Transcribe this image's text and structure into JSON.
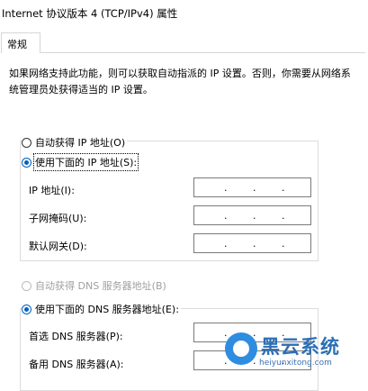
{
  "window": {
    "title": "Internet 协议版本 4 (TCP/IPv4) 属性"
  },
  "tabs": [
    {
      "label": "常规"
    }
  ],
  "description": "如果网络支持此功能，则可以获取自动指派的 IP 设置。否则，你需要从网络系统管理员处获得适当的 IP 设置。",
  "ip_section": {
    "auto_label": "自动获得 IP 地址(O)",
    "manual_label": "使用下面的 IP 地址(S):",
    "selected": "manual",
    "fields": [
      {
        "label": "IP 地址(I):",
        "value": ". . ."
      },
      {
        "label": "子网掩码(U):",
        "value": ". . ."
      },
      {
        "label": "默认网关(D):",
        "value": ". . ."
      }
    ]
  },
  "dns_section": {
    "auto_label": "自动获得 DNS 服务器地址(B)",
    "manual_label": "使用下面的 DNS 服务器地址(E):",
    "selected": "manual",
    "auto_disabled": true,
    "fields": [
      {
        "label": "首选 DNS 服务器(P):"
      },
      {
        "label": "备用 DNS 服务器(A):"
      }
    ]
  },
  "watermark": {
    "name": "黑云系统",
    "url": "heiyunxitong.com"
  },
  "colors": {
    "accent": "#0060c0",
    "border": "#dcdcdc",
    "watermark_blue": "#2b6fb6"
  }
}
